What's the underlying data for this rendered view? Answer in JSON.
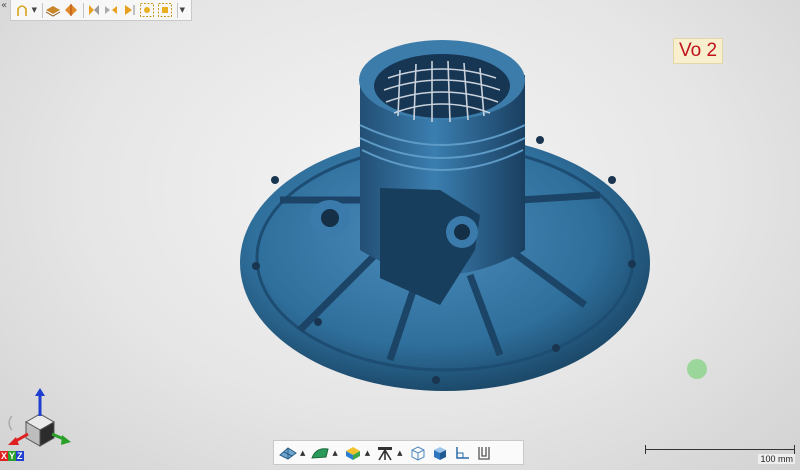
{
  "overlay": {
    "mode_label": "Vo 2",
    "scale_label": "100 mm",
    "axis_letters": [
      "X",
      "Y",
      "Z"
    ]
  },
  "colors": {
    "model": "#2f6f9c",
    "model_dark": "#1c4a6b",
    "mode_label_text": "#c0141c",
    "mode_label_bg": "#f8efcf",
    "dot": "#8ed38e",
    "axis_x": "#e02020",
    "axis_y": "#2aa02a",
    "axis_z": "#1e3fcf"
  },
  "icons": {
    "top_toolbar": [
      "collapse-arrow-icon",
      "outline-shape-icon",
      "layers-icon",
      "color-diamond-icon",
      "split-view-icon",
      "mirror-view-icon",
      "dashed-select-icon",
      "dashed-select-alt-icon"
    ],
    "bottom_toolbar": [
      "mesh-view-icon",
      "surface-view-icon",
      "color-cube-icon",
      "tripod-icon",
      "wireframe-cube-icon",
      "solid-cube-icon",
      "axis-align-icon",
      "cup-outline-icon"
    ]
  }
}
